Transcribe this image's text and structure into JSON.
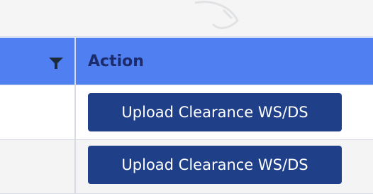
{
  "table": {
    "header": {
      "filter_icon": "filter-icon",
      "action_label": "Action"
    },
    "rows": [
      {
        "action_button_label": "Upload Clearance WS/DS"
      },
      {
        "action_button_label": "Upload Clearance WS/DS"
      }
    ]
  },
  "colors": {
    "header_bg": "#4f7ff0",
    "header_text": "#1b2b6b",
    "button_bg": "#1f3f88",
    "button_text": "#ffffff",
    "row_alt_bg": "#f4f4f4"
  }
}
